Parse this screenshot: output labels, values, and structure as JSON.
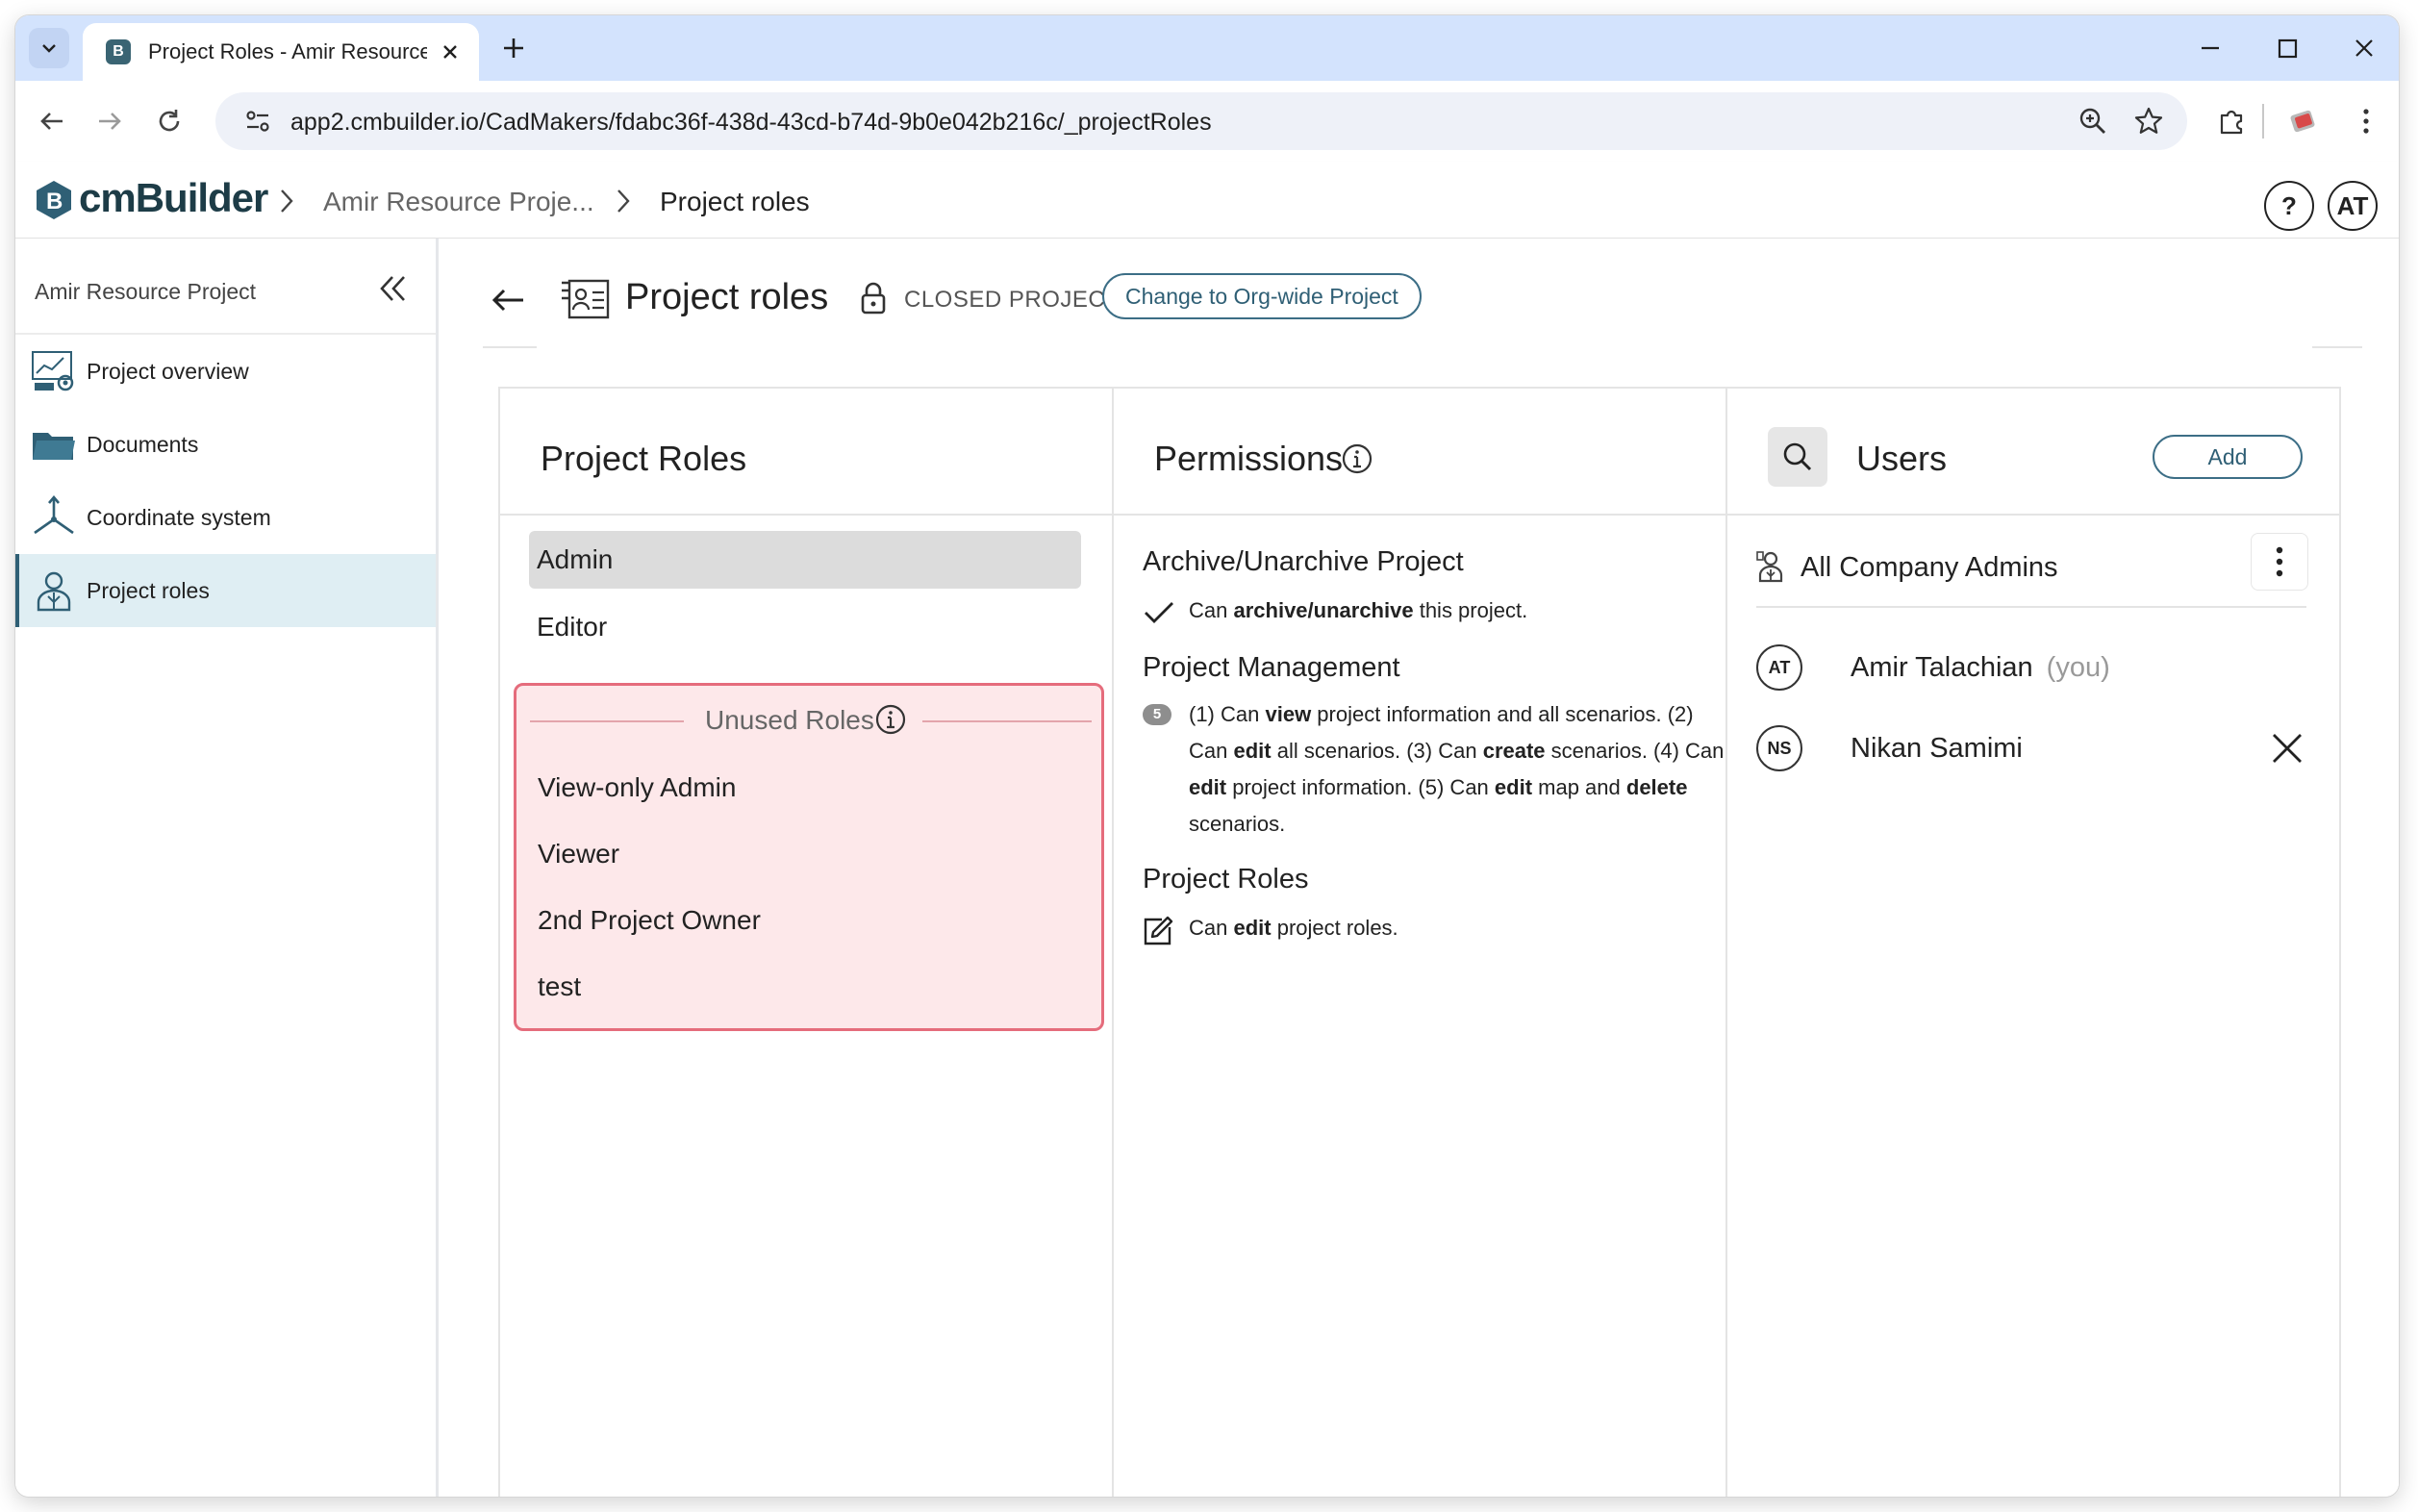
{
  "browser": {
    "tab_title": "Project Roles - Amir Resource P",
    "favicon_letter": "B",
    "url": "app2.cmbuilder.io/CadMakers/fdabc36f-438d-43cd-b74d-9b0e042b216c/_projectRoles"
  },
  "header": {
    "logo_text": "cmBuilder",
    "breadcrumbs": [
      "Amir Resource Proje...",
      "Project roles"
    ],
    "help_label": "?",
    "user_initials": "AT"
  },
  "sidebar": {
    "title": "Amir Resource Project",
    "items": [
      {
        "label": "Project overview",
        "icon": "project-overview-icon"
      },
      {
        "label": "Documents",
        "icon": "folder-icon"
      },
      {
        "label": "Coordinate system",
        "icon": "axes-icon"
      },
      {
        "label": "Project roles",
        "icon": "user-badge-icon",
        "active": true
      }
    ]
  },
  "page": {
    "title": "Project roles",
    "status": "CLOSED PROJECT",
    "change_button": "Change to Org-wide Project"
  },
  "roles_panel": {
    "title": "Project Roles",
    "roles": [
      "Admin",
      "Editor"
    ],
    "selected_role": "Admin",
    "unused_title": "Unused Roles",
    "unused_roles": [
      "View-only Admin",
      "Viewer",
      "2nd Project Owner",
      "test"
    ]
  },
  "permissions_panel": {
    "title": "Permissions",
    "sections": [
      {
        "title": "Archive/Unarchive Project",
        "text": "Can <b>archive/unarchive</b> this project.",
        "icon": "check-icon"
      },
      {
        "title": "Project Management",
        "badge": "5",
        "text": "(1) Can <b>view</b> project information and all scenarios. (2) Can <b>edit</b> all scenarios. (3) Can <b>create</b> scenarios. (4) Can <b>edit</b> project information. (5) Can <b>edit</b> map and <b>delete</b> scenarios."
      },
      {
        "title": "Project Roles",
        "text": "Can <b>edit</b> project roles.",
        "icon": "edit-icon"
      }
    ]
  },
  "users_panel": {
    "title": "Users",
    "add_label": "Add",
    "group": "All Company Admins",
    "users": [
      {
        "initials": "AT",
        "name": "Amir Talachian",
        "note": "(you)"
      },
      {
        "initials": "NS",
        "name": "Nikan Samimi"
      }
    ]
  },
  "colors": {
    "accent": "#2f5f75",
    "unused_border": "#e56c7c",
    "unused_bg": "#fde8ea",
    "active_nav_bg": "#dfeef3"
  }
}
